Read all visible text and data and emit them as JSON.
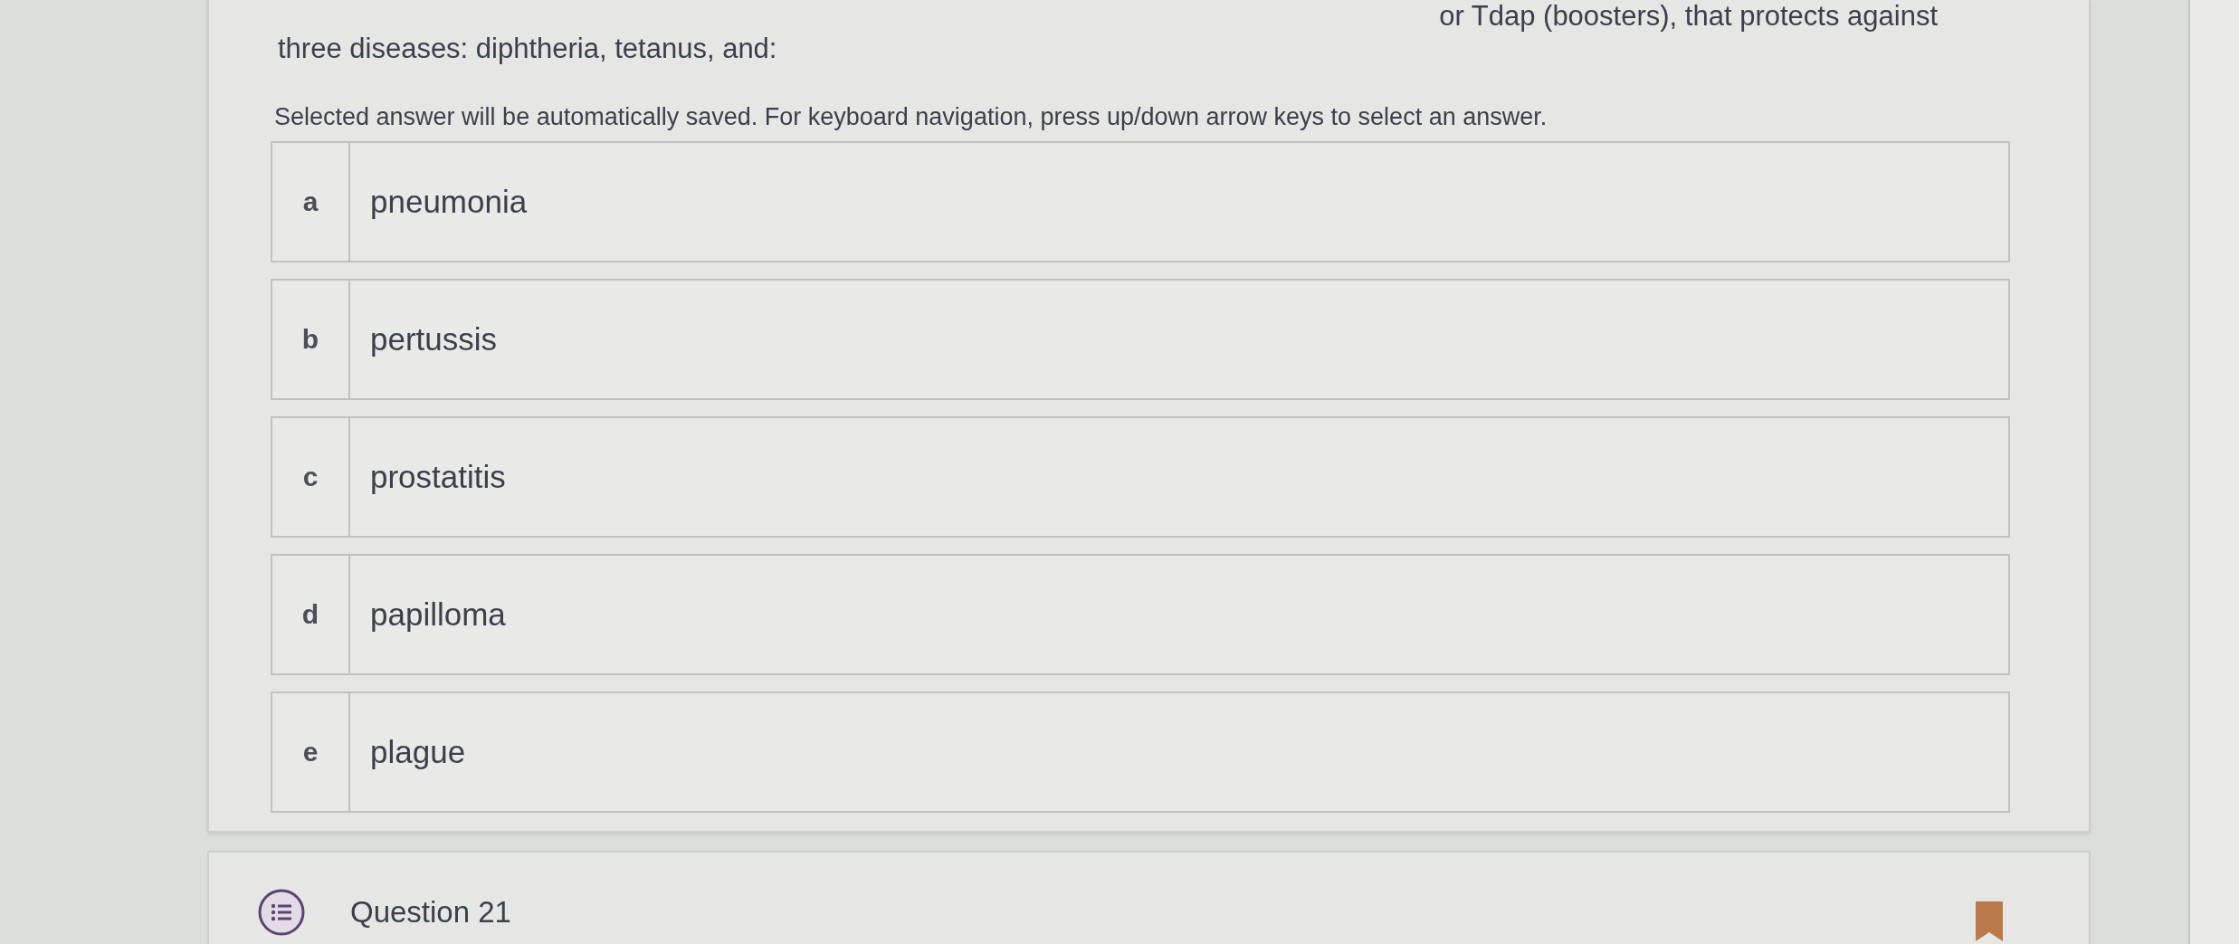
{
  "question": {
    "lines": [
      "or Tdap (boosters), that protects against",
      "three diseases: diphtheria, tetanus, and:"
    ]
  },
  "instructions": "Selected answer will be automatically saved. For keyboard navigation, press up/down arrow keys to select an answer.",
  "options": [
    {
      "letter": "a",
      "label": "pneumonia",
      "selected": false
    },
    {
      "letter": "b",
      "label": "pertussis",
      "selected": false
    },
    {
      "letter": "c",
      "label": "prostatitis",
      "selected": false
    },
    {
      "letter": "d",
      "label": "papilloma",
      "selected": false
    },
    {
      "letter": "e",
      "label": "plague",
      "selected": false
    }
  ],
  "next_question": {
    "title": "Question 21"
  }
}
